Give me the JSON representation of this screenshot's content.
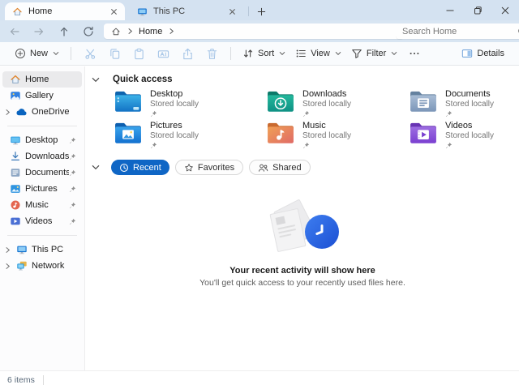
{
  "window": {
    "tabs": [
      {
        "label": "Home",
        "icon": "home-icon",
        "active": true
      },
      {
        "label": "This PC",
        "icon": "pc-icon",
        "active": false
      }
    ]
  },
  "nav": {
    "breadcrumb": {
      "root_icon": "home-icon",
      "current": "Home"
    },
    "search": {
      "placeholder": "Search Home",
      "icon": "search-icon"
    }
  },
  "toolbar": {
    "new_label": "New",
    "sort_label": "Sort",
    "view_label": "View",
    "filter_label": "Filter",
    "details_label": "Details",
    "disabled_icons": [
      "cut-icon",
      "copy-icon",
      "paste-icon",
      "rename-icon",
      "share-icon",
      "delete-icon"
    ]
  },
  "sidebar": {
    "items": [
      {
        "label": "Home",
        "icon": "home-icon",
        "selected": true
      },
      {
        "label": "Gallery",
        "icon": "gallery-icon"
      },
      {
        "label": "OneDrive",
        "icon": "onedrive-icon",
        "expander": true
      },
      {
        "label": "Desktop",
        "icon": "desktop-icon",
        "pinned": true
      },
      {
        "label": "Downloads",
        "icon": "downloads-icon",
        "pinned": true
      },
      {
        "label": "Documents",
        "icon": "documents-icon",
        "pinned": true
      },
      {
        "label": "Pictures",
        "icon": "pictures-icon",
        "pinned": true
      },
      {
        "label": "Music",
        "icon": "music-icon",
        "pinned": true
      },
      {
        "label": "Videos",
        "icon": "videos-icon",
        "pinned": true
      },
      {
        "label": "This PC",
        "icon": "this-pc-icon",
        "expander": true
      },
      {
        "label": "Network",
        "icon": "network-icon",
        "expander": true
      }
    ]
  },
  "quick_access": {
    "title": "Quick access",
    "items": [
      {
        "name": "Desktop",
        "subtitle": "Stored locally",
        "icon": "folder-desktop-icon",
        "pinned": true
      },
      {
        "name": "Downloads",
        "subtitle": "Stored locally",
        "icon": "folder-downloads-icon",
        "pinned": true
      },
      {
        "name": "Documents",
        "subtitle": "Stored locally",
        "icon": "folder-documents-icon",
        "pinned": true
      },
      {
        "name": "Pictures",
        "subtitle": "Stored locally",
        "icon": "folder-pictures-icon",
        "pinned": true
      },
      {
        "name": "Music",
        "subtitle": "Stored locally",
        "icon": "folder-music-icon",
        "pinned": true
      },
      {
        "name": "Videos",
        "subtitle": "Stored locally",
        "icon": "folder-videos-icon",
        "pinned": true
      }
    ]
  },
  "activity_tabs": [
    {
      "label": "Recent",
      "icon": "clock-icon",
      "active": true
    },
    {
      "label": "Favorites",
      "icon": "star-icon",
      "active": false
    },
    {
      "label": "Shared",
      "icon": "people-icon",
      "active": false
    }
  ],
  "empty_state": {
    "title": "Your recent activity will show here",
    "subtitle": "You'll get quick access to your recently used files here."
  },
  "status_bar": {
    "items_count": "6 items"
  },
  "colors": {
    "accent": "#0f66c5",
    "titlebar": "#d4e2f1",
    "disabled_toolbar_icon": "#a7c6e7",
    "folder_desktop": "#1f86d6",
    "folder_downloads": "#14a38f",
    "folder_documents": "#8aa4c2",
    "folder_pictures": "#1f86d6",
    "folder_music": "#e8854f",
    "folder_videos": "#8a55d8",
    "clock_badge": "#2a63dd"
  },
  "icons": {
    "home-icon": "house outline",
    "pc-icon": "monitor",
    "search-icon": "magnifier",
    "cut-icon": "scissors",
    "copy-icon": "two sheets",
    "paste-icon": "clipboard",
    "rename-icon": "rename box",
    "share-icon": "arrow out of box",
    "delete-icon": "trash can",
    "clock-icon": "clock face",
    "star-icon": "star outline",
    "people-icon": "two people",
    "pin-icon": "pushpin"
  }
}
